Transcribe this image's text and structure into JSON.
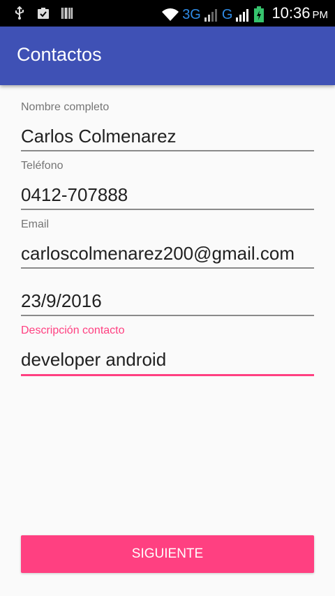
{
  "status_bar": {
    "left_icons": [
      "usb-icon",
      "clipboard-check-icon",
      "barcode-icon"
    ],
    "network_1": "3G",
    "network_2": "G",
    "time": "10:36",
    "ampm": "PM",
    "colors": {
      "background": "#000000",
      "network": "#2f8be6",
      "battery": "#36c36d"
    }
  },
  "app_bar": {
    "title": "Contactos",
    "color": "#3f51b5"
  },
  "form": {
    "fields": [
      {
        "label": "Nombre completo",
        "value": "Carlos Colmenarez"
      },
      {
        "label": "Teléfono",
        "value": "0412-707888"
      },
      {
        "label": "Email",
        "value": "carloscolmenarez200@gmail.com"
      },
      {
        "label": "",
        "value": "23/9/2016"
      },
      {
        "label": "Descripción contacto",
        "value": "developer android",
        "focused": true
      }
    ]
  },
  "accent_color": "#ff4081",
  "submit_button": {
    "label": "SIGUIENTE"
  }
}
